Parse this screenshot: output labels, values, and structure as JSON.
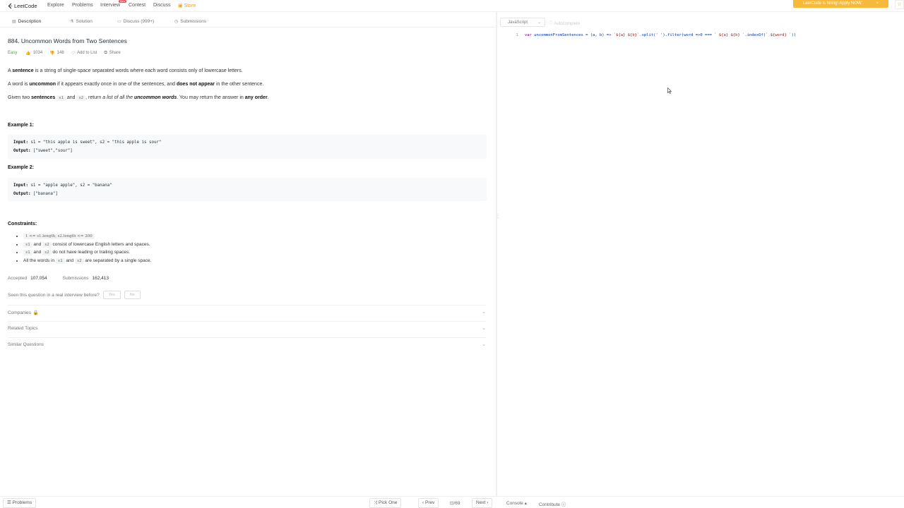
{
  "nav": {
    "logo": "LeetCode",
    "links": [
      "Explore",
      "Problems",
      "Interview",
      "Contest",
      "Discuss",
      "Store"
    ],
    "new_badge": "New",
    "promo": "LeetCode is hiring! Apply NOW.",
    "promo_close": "×"
  },
  "tabs": [
    "Description",
    "Solution",
    "Discuss (999+)",
    "Submissions"
  ],
  "problem": {
    "title": "884. Uncommon Words from Two Sentences",
    "difficulty": "Easy",
    "likes": "1034",
    "dislikes": "148",
    "add_to_list": "Add to List",
    "share": "Share",
    "p1": {
      "pre": "A ",
      "b1": "sentence",
      "post": " is a string of single-space separated words where each word consists only of lowercase letters."
    },
    "p2": {
      "pre": "A word is ",
      "b1": "uncommon",
      "mid": " if it appears exactly once in one of the sentences, and ",
      "b2": "does not appear",
      "post": " in the other sentence."
    },
    "p3": {
      "pre": "Given two ",
      "b1": "sentences",
      "s1": "s1",
      "and": " and ",
      "s2": "s2",
      "mid": ", return ",
      "i1": "a list of all the ",
      "bi": "uncommon words",
      "mid2": ". You may return the answer in ",
      "b2": "any order",
      "post": "."
    },
    "example1": {
      "heading": "Example 1:",
      "input_label": "Input:",
      "input": " s1 = \"this apple is sweet\", s2 = \"this apple is sour\"",
      "output_label": "Output:",
      "output": " [\"sweet\",\"sour\"]"
    },
    "example2": {
      "heading": "Example 2:",
      "input_label": "Input:",
      "input": " s1 = \"apple apple\", s2 = \"banana\"",
      "output_label": "Output:",
      "output": " [\"banana\"]"
    },
    "constraints_heading": "Constraints:",
    "constraints": {
      "c1": "1 <= s1.length, s2.length <= 200",
      "c2_s1": "s1",
      "c2_and": " and ",
      "c2_s2": "s2",
      "c2_post": " consist of lowercase English letters and spaces.",
      "c3_s1": "s1",
      "c3_and": " and ",
      "c3_s2": "s2",
      "c3_post": " do not have leading or trailing spaces.",
      "c4_pre": "All the words in ",
      "c4_s1": "s1",
      "c4_and": " and ",
      "c4_s2": "s2",
      "c4_post": " are separated by a single space."
    },
    "accepted_label": "Accepted",
    "accepted": "107,054",
    "submissions_label": "Submissions",
    "submissions": "162,413",
    "interview_q": "Seen this question in a real interview before?",
    "yes": "Yes",
    "no": "No",
    "accordions": [
      "Companies",
      "Related Topics",
      "Similar Questions"
    ]
  },
  "editor": {
    "language": "JavaScript",
    "autocomplete": "Autocomplete",
    "line_number": "1",
    "code": {
      "kw": "var",
      "a": " uncommonFromSentences = (a, b) => ",
      "t1": "`${a} ${b}`",
      "b": ".split(",
      "t2": "' '",
      "c": ").filter(word =>0 === ",
      "t3": "` ${a} ${b} `",
      "d": ".indexOf(",
      "t4": "` ${word} `",
      "e": "))"
    }
  },
  "bottom": {
    "problems": "Problems",
    "pick_one": "Pick One",
    "prev": "Prev",
    "page": "/69",
    "next": "Next",
    "console": "Console",
    "contribute": "Contribute"
  },
  "colors": {
    "accent": "#f0a020",
    "easy": "#43a047",
    "promo": "#f6b93b"
  }
}
